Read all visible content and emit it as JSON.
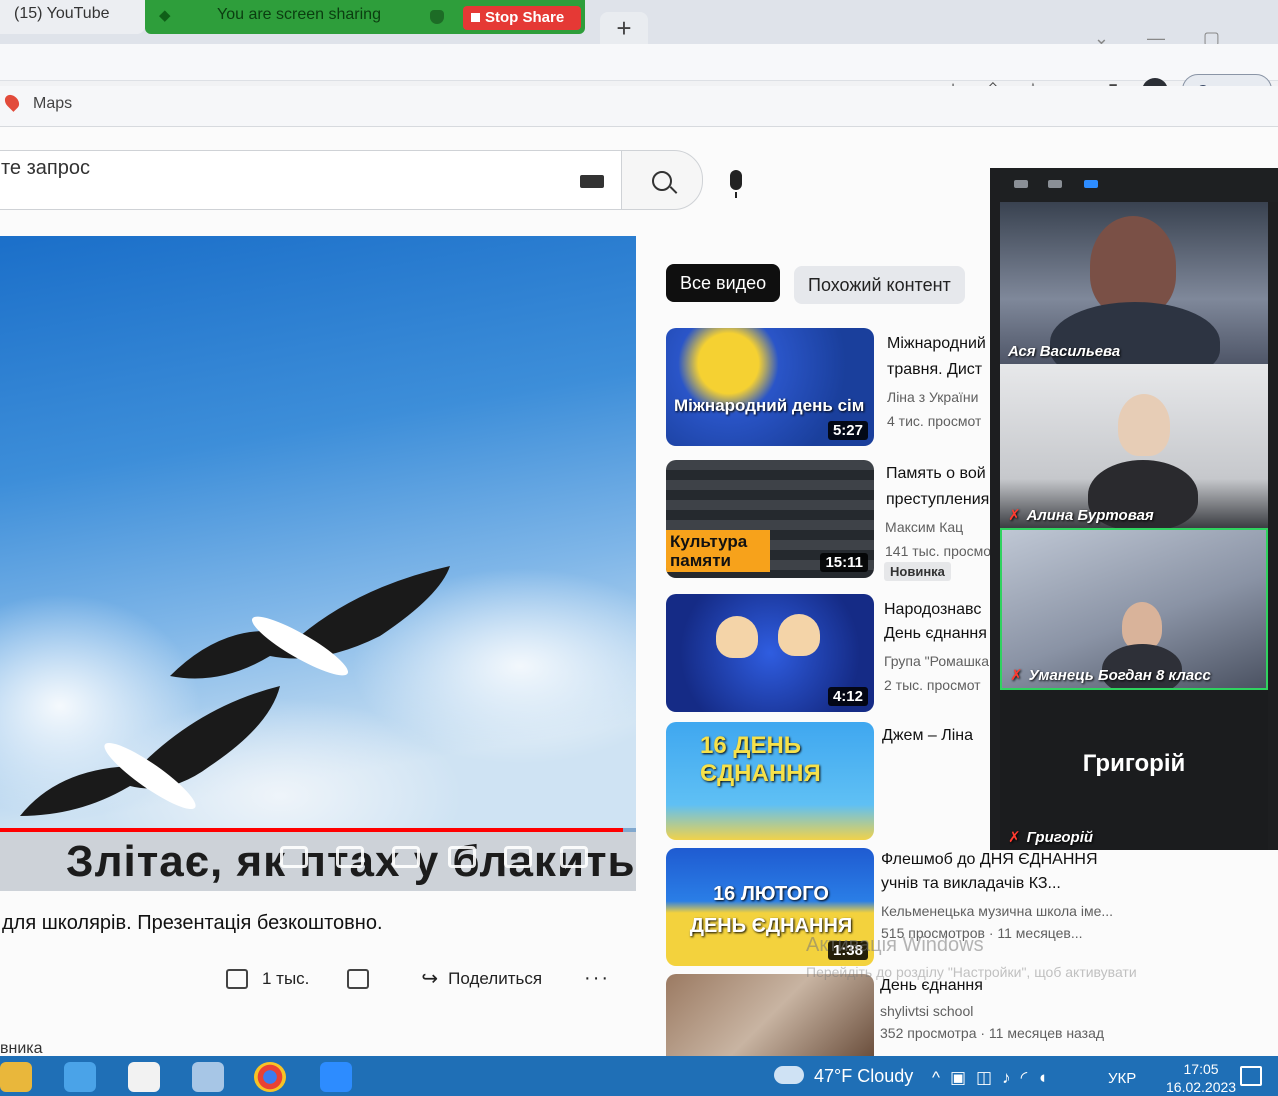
{
  "browser": {
    "tab_youtube": "(15) YouTube",
    "zoom_sharing_text": "You are screen sharing",
    "stop_share": "Stop Share",
    "new_tab": "+",
    "update_button": "Оновити",
    "avatar_letter": "A",
    "bookmark_maps": "Maps"
  },
  "search": {
    "placeholder": "те запрос"
  },
  "player": {
    "caption": "Злітає, як птах у блакить",
    "progress_percent": 98,
    "description": "для школярів. Презентація безкоштовно.",
    "likes": "1 тыс.",
    "share": "Поделиться",
    "more": "···",
    "bottom_text": "вника"
  },
  "chips": {
    "all": "Все видео",
    "similar": "Похожий контент"
  },
  "recommendations": [
    {
      "thumb_text": "Міжнародний день сім",
      "duration": "5:27",
      "title_1": "Міжнародний",
      "title_2": "травня. Дист",
      "channel": "Ліна з України",
      "views": "4 тис. просмот"
    },
    {
      "thumb_text": "Культура памяти",
      "duration": "15:11",
      "title_1": "Память о вой",
      "title_2": "преступления",
      "channel": "Максим Кац",
      "views": "141 тыс. просмо",
      "badge": "Новинка"
    },
    {
      "thumb_text": "",
      "duration": "4:12",
      "title_1": "Народознавс",
      "title_2": "День єднання",
      "channel": "Група \"Ромашка",
      "views": "2 тыс. просмот"
    },
    {
      "thumb_text": "16 ДЕНЬ ЄДНАННЯ",
      "duration": "",
      "title_1": "Джем – Ліна",
      "title_2": "",
      "channel": "",
      "views": ""
    },
    {
      "thumb_text": "16 ЛЮТОГО ДЕНЬ ЄДНАННЯ",
      "duration": "1:38",
      "title_1": "Флешмоб до ДНЯ ЄДНАННЯ",
      "title_2": "учнів та викладачів КЗ...",
      "channel": "Кельменецька музична школа іме...",
      "views": "515 просмотров · 11 месяцев..."
    },
    {
      "thumb_text": "",
      "duration": "",
      "title_1": "День єднання",
      "title_2": "",
      "channel": "shylivtsi school",
      "views": "352 просмотра · 11 месяцев назад"
    }
  ],
  "windows_activation": {
    "line1": "Активація Windows",
    "line2": "Перейдіть до розділу \"Настройки\", щоб активувати"
  },
  "zoom": {
    "participants": [
      {
        "name": "Ася Васильева",
        "muted": false
      },
      {
        "name": "Алина Буртовая",
        "muted": true
      },
      {
        "name": "Уманець Богдан 8 класс",
        "muted": true
      },
      {
        "name": "Григорій",
        "muted": true
      }
    ],
    "big_name": "Григорій"
  },
  "taskbar": {
    "weather": "47°F Cloudy",
    "language": "УКР",
    "time": "17:05",
    "date": "16.02.2023"
  }
}
